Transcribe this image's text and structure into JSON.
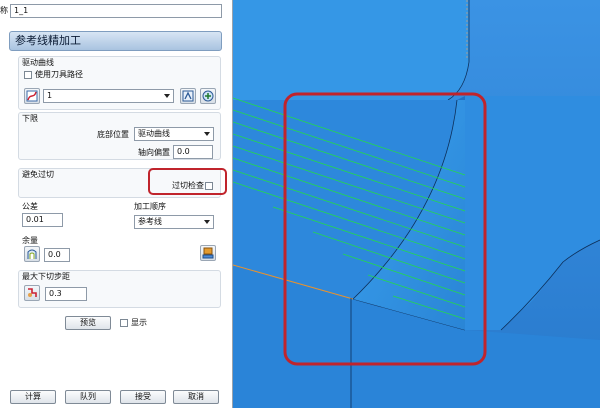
{
  "name_row": {
    "label": "称",
    "value": "1_1"
  },
  "section": {
    "title": "参考线精加工"
  },
  "drive_curve": {
    "heading": "驱动曲线",
    "use_tool_path_label": "使用刀具路径",
    "curve_value": "1"
  },
  "lower_limit": {
    "heading": "下限",
    "bottom_position_label": "底部位置",
    "bottom_position_value": "驱动曲线",
    "axial_offset_label": "轴向偏置",
    "axial_offset_value": "0.0"
  },
  "gouge_avoid": {
    "heading": "避免过切",
    "gouge_check_label": "过切检查"
  },
  "tolerance": {
    "label": "公差",
    "value": "0.01"
  },
  "machining_order": {
    "label": "加工顺序",
    "value": "参考线"
  },
  "allowance": {
    "label": "余量",
    "value": "0.0"
  },
  "max_stepdown": {
    "label": "最大下切步距",
    "value": "0.3"
  },
  "preview": {
    "button_label": "预览",
    "show_label": "显示"
  },
  "footer": {
    "calculate": "计算",
    "queue": "队列",
    "accept": "接受",
    "cancel": "取消"
  },
  "colors": {
    "viewport_bg": "#2a82d8",
    "surface": "#2f8bde",
    "toolpath": "#23d84f",
    "highlight_box": "#c0242c"
  }
}
